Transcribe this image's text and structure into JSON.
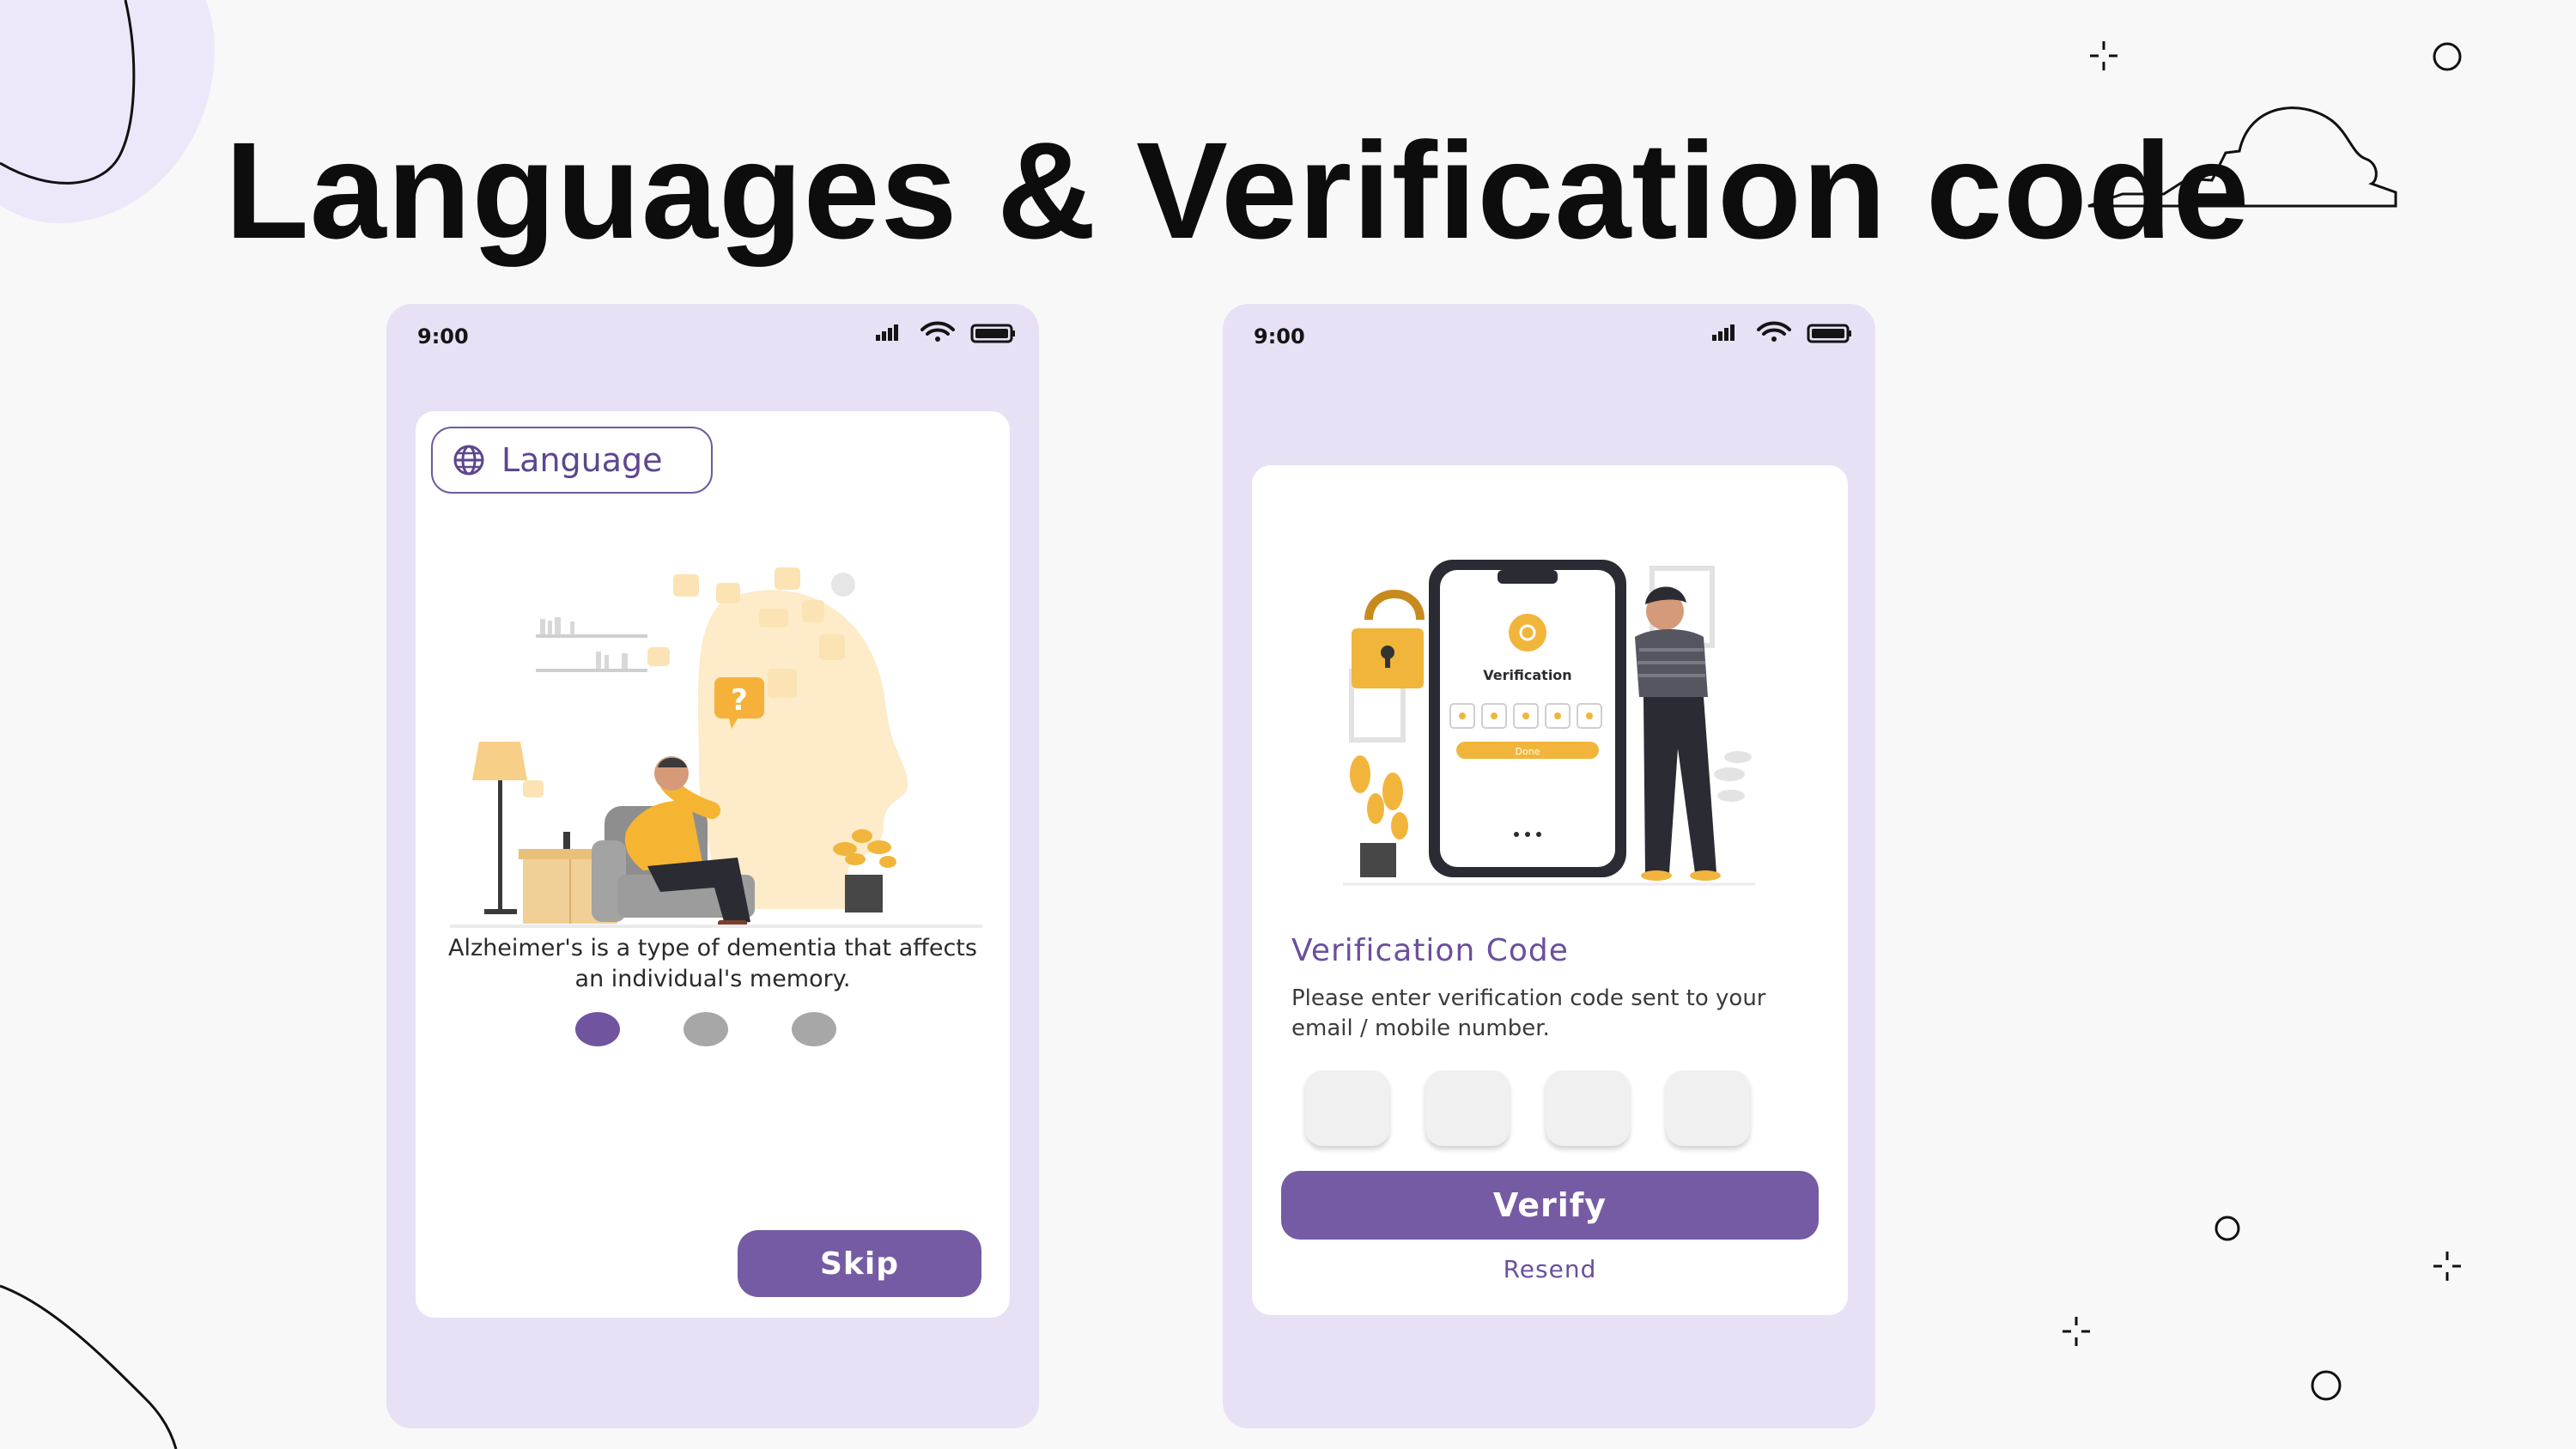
{
  "title": "Languages & Verification code",
  "colors": {
    "accent": "#755ba3",
    "phone_bg": "#e8e0f5",
    "illustration_yellow": "#f3b73a"
  },
  "phone1": {
    "status_time": "9:00",
    "language_label": "Language",
    "description": "Alzheimer's is a type of dementia that affects an individual's memory.",
    "pager": {
      "total": 3,
      "active": 1
    },
    "skip_label": "Skip"
  },
  "phone2": {
    "status_time": "9:00",
    "illustration_caption": "Verification",
    "illustration_button": "Done",
    "heading": "Verification Code",
    "description": "Please enter verification code sent to your email / mobile number.",
    "otp_values": [
      "",
      "",
      "",
      ""
    ],
    "verify_label": "Verify",
    "resend_label": "Resend"
  }
}
